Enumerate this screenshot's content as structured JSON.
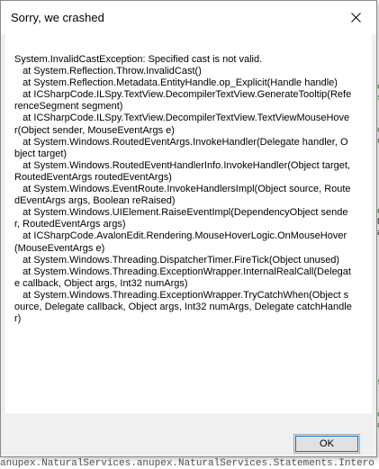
{
  "background": {
    "bottom_text": "anupex.NaturalServices.anupex.NaturalServices.Statements.Intero",
    "fragments": [
      "e",
      "se",
      "c",
      "e",
      "e",
      "N",
      "a",
      "s",
      "ce",
      "de"
    ]
  },
  "dialog": {
    "title": "Sorry, we crashed",
    "message": "System.InvalidCastException: Specified cast is not valid.\n   at System.Reflection.Throw.InvalidCast()\n   at System.Reflection.Metadata.EntityHandle.op_Explicit(Handle handle)\n   at ICSharpCode.ILSpy.TextView.DecompilerTextView.GenerateTooltip(ReferenceSegment segment)\n   at ICSharpCode.ILSpy.TextView.DecompilerTextView.TextViewMouseHover(Object sender, MouseEventArgs e)\n   at System.Windows.RoutedEventArgs.InvokeHandler(Delegate handler, Object target)\n   at System.Windows.RoutedEventHandlerInfo.InvokeHandler(Object target, RoutedEventArgs routedEventArgs)\n   at System.Windows.EventRoute.InvokeHandlersImpl(Object source, RoutedEventArgs args, Boolean reRaised)\n   at System.Windows.UIElement.RaiseEventImpl(DependencyObject sender, RoutedEventArgs args)\n   at ICSharpCode.AvalonEdit.Rendering.MouseHoverLogic.OnMouseHover(MouseEventArgs e)\n   at System.Windows.Threading.DispatcherTimer.FireTick(Object unused)\n   at System.Windows.Threading.ExceptionWrapper.InternalRealCall(Delegate callback, Object args, Int32 numArgs)\n   at System.Windows.Threading.ExceptionWrapper.TryCatchWhen(Object source, Delegate callback, Object args, Int32 numArgs, Delegate catchHandler)",
    "ok_label": "OK"
  },
  "colors": {
    "accent": "#0078d7",
    "window_bg": "#f0f0f0",
    "content_bg": "#ffffff"
  },
  "icons": {
    "close": "close-icon"
  }
}
